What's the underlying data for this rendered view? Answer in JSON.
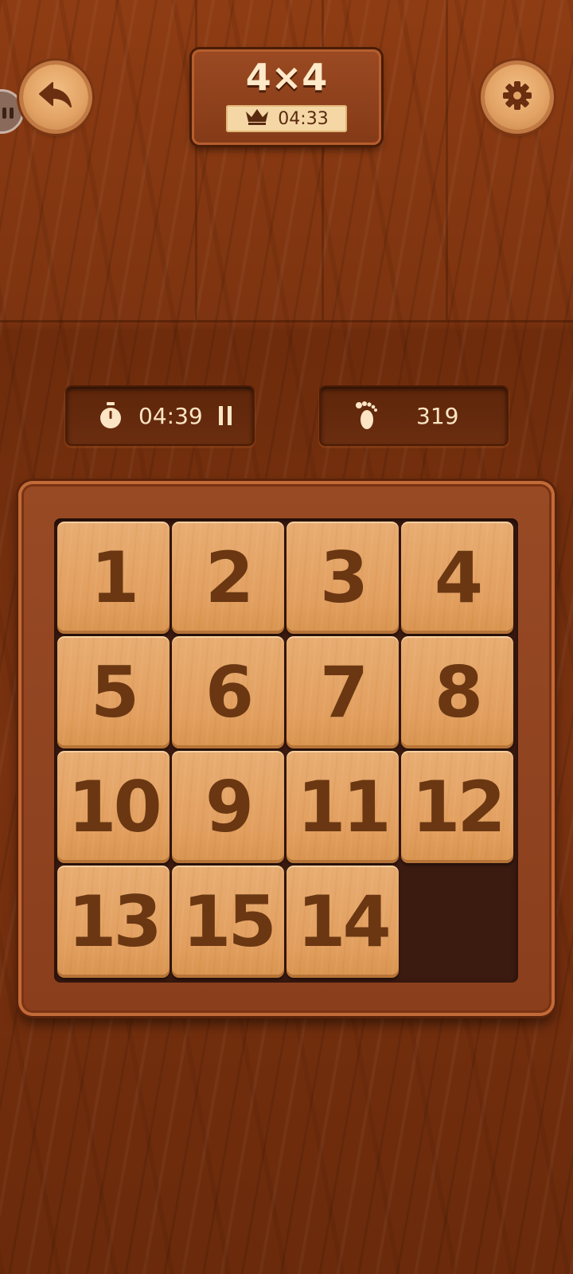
{
  "header": {
    "title": "4×4",
    "best_time": "04:33",
    "back_icon": "back-arrow-icon",
    "settings_icon": "gear-icon",
    "best_icon": "crown-icon"
  },
  "stats": {
    "timer": "04:39",
    "timer_icon": "stopwatch-icon",
    "pause_icon": "pause-icon",
    "moves": "319",
    "moves_icon": "footprint-icon"
  },
  "board": {
    "size": 4,
    "tiles": [
      "1",
      "2",
      "3",
      "4",
      "5",
      "6",
      "7",
      "8",
      "10",
      "9",
      "11",
      "12",
      "13",
      "15",
      "14",
      ""
    ]
  },
  "colors": {
    "tile_number": "#6a3712",
    "tile_face": "#e29f5f",
    "frame": "#8a3e1c",
    "background": "#7a3210"
  }
}
